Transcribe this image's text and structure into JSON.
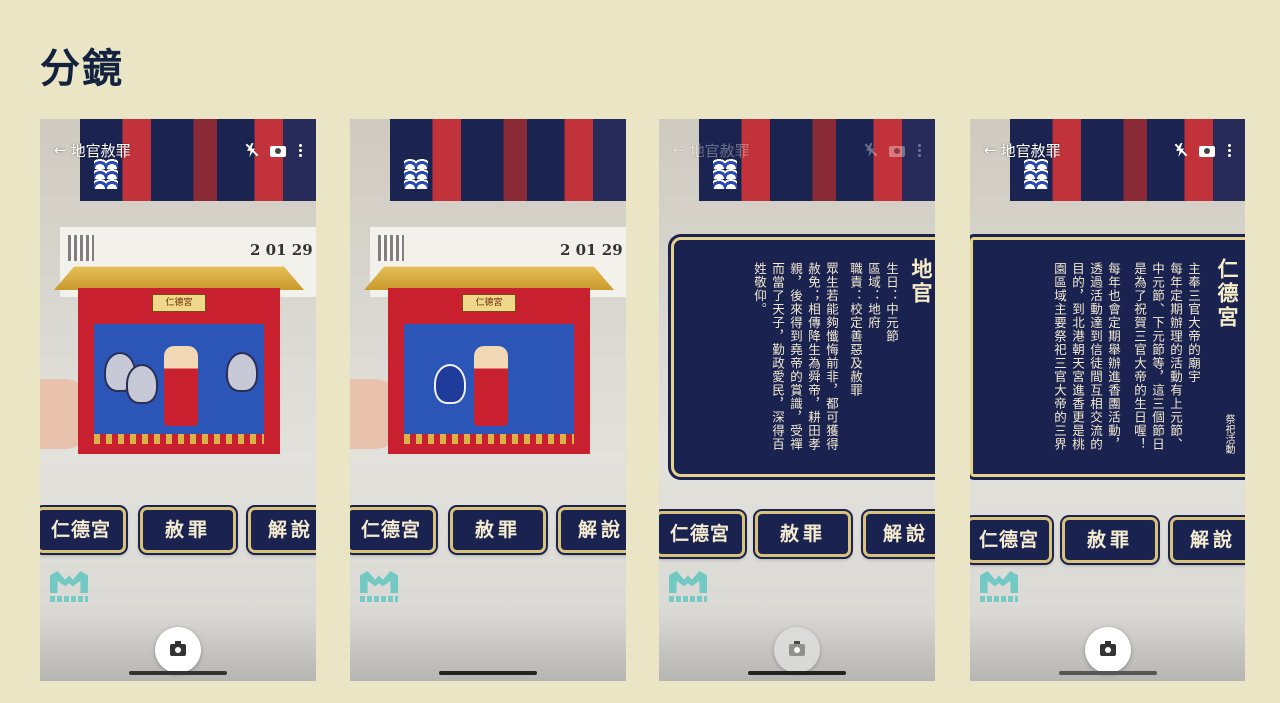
{
  "page": {
    "title": "分鏡"
  },
  "screens": [
    {
      "id": "screen-1",
      "top_bar": {
        "back_label": "地官赦罪",
        "dimmed": false
      },
      "buttons": [
        "仁德宮",
        "赦罪",
        "解說"
      ],
      "shutter_dimmed": false,
      "overlay": "temple"
    },
    {
      "id": "screen-2",
      "top_bar": {
        "back_label": "",
        "dimmed": false
      },
      "buttons": [
        "仁德宮",
        "赦罪",
        "解說"
      ],
      "shutter_dimmed": false,
      "overlay": "temple"
    },
    {
      "id": "screen-3",
      "top_bar": {
        "back_label": "地官赦罪",
        "dimmed": true
      },
      "buttons": [
        "仁德宮",
        "赦罪",
        "解說"
      ],
      "shutter_dimmed": true,
      "overlay": "info",
      "info": {
        "title": "地官",
        "columns": [
          "生日：中元節",
          "區域：地府",
          "職責：校定善惡及赦罪",
          "眾生若能夠懺悔前非，都可獲得",
          "赦免；相傳降生為舜帝，耕田孝",
          "親，後來得到堯帝的賞識，受禪",
          "而當了天子，勤政愛民，深得百",
          "姓敬仰。"
        ],
        "side_note": ""
      }
    },
    {
      "id": "screen-4",
      "top_bar": {
        "back_label": "地官赦罪",
        "dimmed": false
      },
      "buttons": [
        "仁德宮",
        "赦罪",
        "解說"
      ],
      "shutter_dimmed": false,
      "overlay": "info",
      "info": {
        "title": "仁德宮",
        "columns": [
          "主奉三官大帝的廟宇",
          "每年定期辦理的活動有上元節、",
          "中元節、下元節等，這三個節日",
          "是為了祝賀三官大帝的生日喔！",
          "每年也會定期舉辦進香團活動，",
          "透過活動達到信徒間互相交流的",
          "目的，到北港朝天宮進香更是桃",
          "園區域主要祭祀三官大帝的三界"
        ],
        "side_note": "祭祀活動"
      }
    }
  ],
  "temple": {
    "sign": "仁德宮",
    "poster_date": "2 01 29"
  },
  "colors": {
    "background": "#e9e5c5",
    "navy": "#1a2250",
    "gold": "#d9c27a",
    "teal": "#5fc6c0"
  }
}
